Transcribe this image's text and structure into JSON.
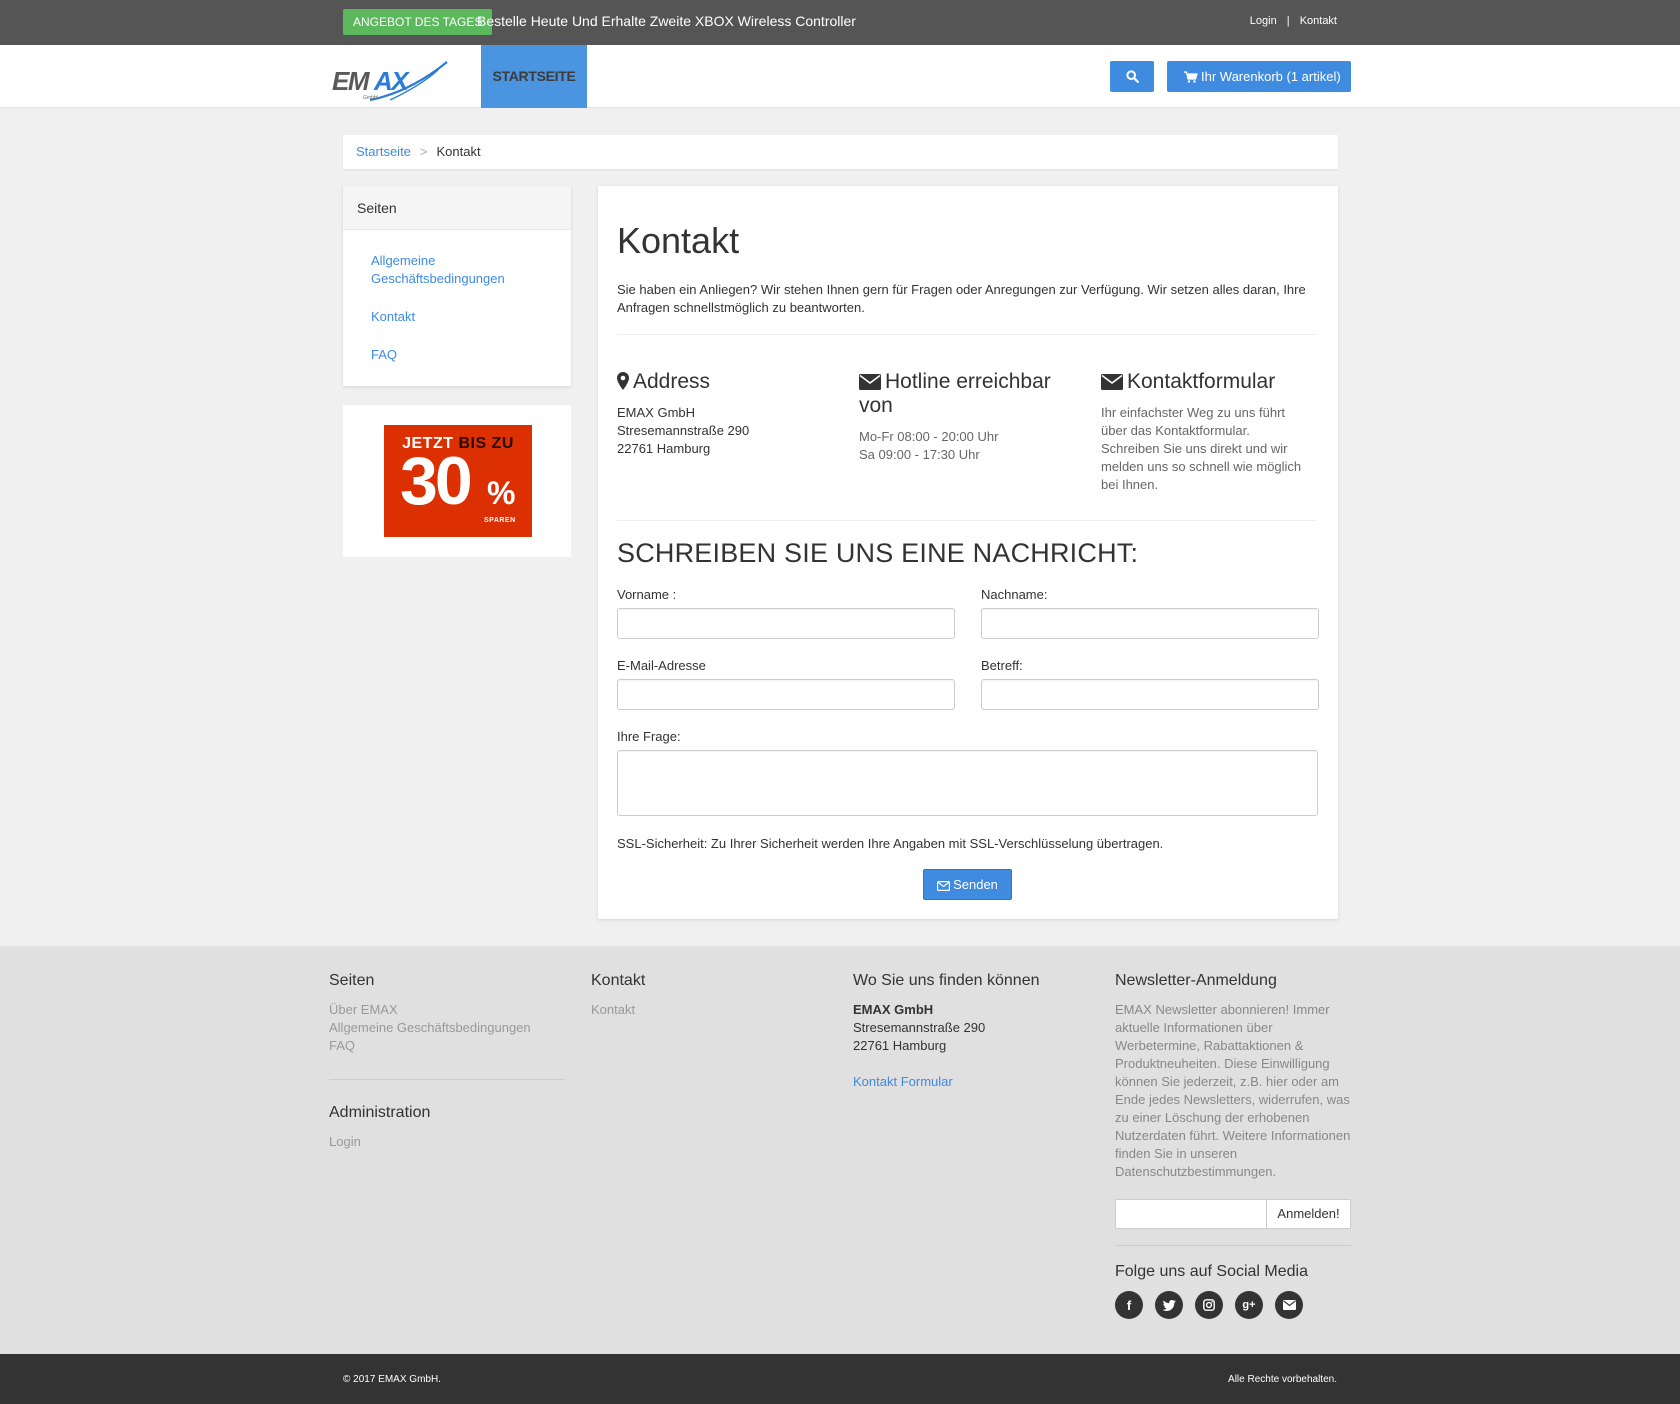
{
  "topbar": {
    "deal_badge": "ANGEBOT DES TAGES",
    "deal_text": "Bestelle Heute Und Erhalte Zweite XBOX Wireless Controller",
    "login": "Login",
    "separator": "|",
    "contact": "Kontakt"
  },
  "header": {
    "logo_text": "EMAX",
    "logo_sub": "GmbH",
    "nav_home": "STARTSEITE",
    "search_icon": "search-icon",
    "cart_label": "Ihr Warenkorb (1 artikel)",
    "accent": "#3e8be0"
  },
  "breadcrumb": {
    "home": "Startseite",
    "separator": ">",
    "current": "Kontakt"
  },
  "sidebar": {
    "title": "Seiten",
    "items": [
      {
        "label": "Allgemeine Geschäftsbedingungen"
      },
      {
        "label": "Kontakt"
      },
      {
        "label": "FAQ"
      }
    ],
    "promo": {
      "line1_a": "JETZT",
      "line1_b": "BIS ZU",
      "big": "30",
      "pct": "%",
      "sub": "SPAREN",
      "color": "#dc2f02"
    }
  },
  "main": {
    "title": "Kontakt",
    "intro": "Sie haben ein Anliegen? Wir stehen Ihnen gern für Fragen oder Anregungen zur Verfügung. Wir setzen alles daran, Ihre Anfragen schnellstmöglich zu beantworten.",
    "address": {
      "title": "Address",
      "line1": "EMAX GmbH",
      "line2": "Stresemannstraße 290",
      "line3": "22761 Hamburg"
    },
    "hotline": {
      "title": "Hotline erreichbar von",
      "line1": "Mo-Fr 08:00 - 20:00 Uhr",
      "line2": "Sa 09:00 - 17:30 Uhr"
    },
    "contactform": {
      "title": "Kontaktformular",
      "text": "Ihr einfachster Weg zu uns führt über das Kontaktformular. Schreiben Sie uns direkt und wir melden uns so schnell wie möglich bei Ihnen."
    },
    "form": {
      "title": "SCHREIBEN SIE UNS EINE NACHRICHT:",
      "firstname_label": "Vorname :",
      "lastname_label": "Nachname:",
      "email_label": "E-Mail-Adresse",
      "subject_label": "Betreff:",
      "question_label": "Ihre Frage:",
      "firstname_value": "",
      "lastname_value": "",
      "email_value": "",
      "subject_value": "",
      "question_value": "",
      "ssl_note": "SSL-Sicherheit: Zu Ihrer Sicherheit werden Ihre Angaben mit SSL-Verschlüsselung übertragen.",
      "send_label": "Senden"
    }
  },
  "footer": {
    "pages": {
      "title": "Seiten",
      "links": [
        "Über EMAX",
        "Allgemeine Geschäftsbedingungen",
        "FAQ"
      ]
    },
    "admin": {
      "title": "Administration",
      "login": "Login"
    },
    "contact": {
      "title": "Kontakt",
      "link": "Kontakt"
    },
    "location": {
      "title": "Wo Sie uns finden können",
      "company": "EMAX GmbH",
      "street": "Stresemannstraße 290",
      "city": "22761 Hamburg",
      "form_link": "Kontakt Formular"
    },
    "newsletter": {
      "title": "Newsletter-Anmeldung",
      "text": "EMAX Newsletter abonnieren! Immer aktuelle Informationen über Werbetermine, Rabattaktionen & Produktneuheiten. Diese Einwilligung können Sie jederzeit, z.B. hier oder am Ende jedes Newsletters, widerrufen, was zu einer Löschung der erhobenen Nutzerdaten führt. Weitere Informationen finden Sie in unseren Datenschutzbestimmungen.",
      "input_value": "",
      "button": "Anmelden!"
    },
    "social": {
      "title": "Folge uns auf Social Media",
      "icons": [
        "facebook-icon",
        "twitter-icon",
        "instagram-icon",
        "google-plus-icon",
        "email-icon"
      ]
    }
  },
  "bottombar": {
    "copyright": "© 2017 EMAX GmbH.",
    "rights": "Alle Rechte vorbehalten."
  }
}
